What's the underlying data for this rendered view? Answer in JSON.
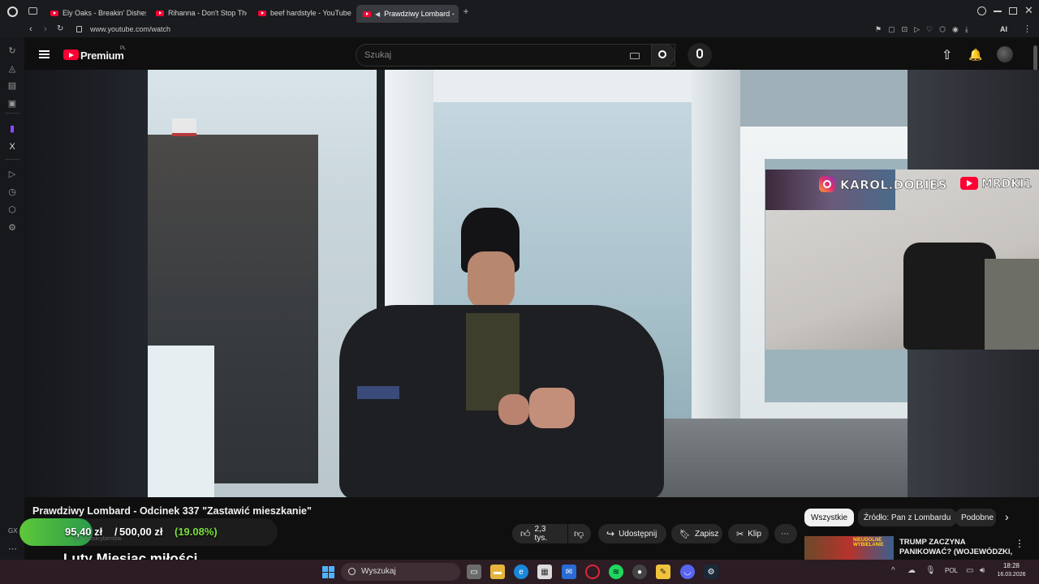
{
  "browser": {
    "tabs": [
      {
        "label": "Ely Oaks - Breakin' Dishes"
      },
      {
        "label": "Rihanna - Don't Stop The"
      },
      {
        "label": "beef hardstyle - YouTube"
      },
      {
        "label": "Prawdziwy Lombard -"
      }
    ],
    "url": "www.youtube.com/watch",
    "ai_label": "AI"
  },
  "youtube": {
    "logo_text": "Premium",
    "logo_region": "PL",
    "search_placeholder": "Szukaj"
  },
  "video": {
    "title": "Prawdziwy Lombard - Odcinek 337 \"Zastawić mieszkanie\"",
    "overlay_instagram": "KAROL.DOBIES",
    "overlay_youtube": "MRDKI1"
  },
  "actions": {
    "likes": "2,3 tys.",
    "share": "Udostępnij",
    "save": "Zapisz",
    "clip": "Klip"
  },
  "donation_overlay": {
    "progress": "95,40 zł / 500,00 zł",
    "current": "95,40 zł",
    "goal": "500,00 zł",
    "percent": "(19.08%)",
    "percent_value": 19.08,
    "subtitle": "Luty Miesiąc miłości",
    "channel_fragment": "tys. subskrybentów"
  },
  "recommendations": {
    "chips": [
      "Wszystkie",
      "Źródło: Pan z Lombardu",
      "Podobne"
    ],
    "first_title": "TRUMP ZACZYNA PANIKOWAĆ? (WOJEWÓDZKI, ...",
    "thumb_text": "NIEUDOLNE WYBIELANIE"
  },
  "taskbar": {
    "search": "Wyszukaj",
    "lang": "POL",
    "time": "18:28",
    "date": "16.03.2026"
  },
  "colors": {
    "accent_red": "#ff0033",
    "donation_green": "#79e03c",
    "taskbar_bg": "#2b1d23"
  }
}
